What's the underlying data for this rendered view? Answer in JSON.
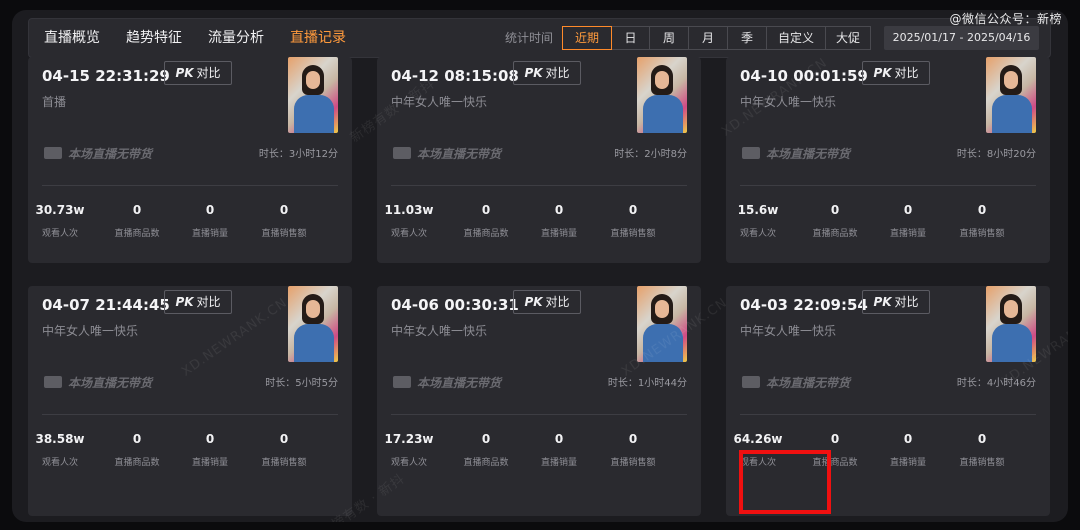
{
  "corner_label": "@微信公众号：新榜",
  "nav": {
    "tabs": [
      {
        "label": "直播概览"
      },
      {
        "label": "趋势特征"
      },
      {
        "label": "流量分析"
      },
      {
        "label": "直播记录"
      }
    ]
  },
  "filter": {
    "label": "统计时间",
    "periods": [
      {
        "label": "近期"
      },
      {
        "label": "日"
      },
      {
        "label": "周"
      },
      {
        "label": "月"
      },
      {
        "label": "季"
      },
      {
        "label": "自定义"
      },
      {
        "label": "大促"
      }
    ],
    "active_period": "近期",
    "date_range": "2025/01/17 - 2025/04/16"
  },
  "pk_label": "对比",
  "pk_mark": "PK",
  "no_goods_text": "本场直播无带货",
  "metric_labels": [
    "观看人次",
    "直播商品数",
    "直播销量",
    "直播销售额"
  ],
  "watermark_text": "XD.NEWRANK.CN",
  "watermark_text_2": "新榜有数 · 新抖",
  "cards": [
    {
      "datetime": "04-15 22:31:29",
      "subtitle": "首播",
      "duration": "时长：3小时12分",
      "metrics": [
        "30.73w",
        "0",
        "0",
        "0"
      ]
    },
    {
      "datetime": "04-12 08:15:08",
      "subtitle": "中年女人唯一快乐",
      "duration": "时长：2小时8分",
      "metrics": [
        "11.03w",
        "0",
        "0",
        "0"
      ]
    },
    {
      "datetime": "04-10 00:01:59",
      "subtitle": "中年女人唯一快乐",
      "duration": "时长：8小时20分",
      "metrics": [
        "15.6w",
        "0",
        "0",
        "0"
      ]
    },
    {
      "datetime": "04-07 21:44:45",
      "subtitle": "中年女人唯一快乐",
      "duration": "时长：5小时5分",
      "metrics": [
        "38.58w",
        "0",
        "0",
        "0"
      ]
    },
    {
      "datetime": "04-06 00:30:31",
      "subtitle": "中年女人唯一快乐",
      "duration": "时长：1小时44分",
      "metrics": [
        "17.23w",
        "0",
        "0",
        "0"
      ]
    },
    {
      "datetime": "04-03 22:09:54",
      "subtitle": "中年女人唯一快乐",
      "duration": "时长：4小时46分",
      "metrics": [
        "64.26w",
        "0",
        "0",
        "0"
      ]
    }
  ],
  "colors": {
    "accent": "#ff9a3c",
    "highlight": "#f01010",
    "card_bg": "#2a2a2f",
    "page_bg": "#1c1c20"
  }
}
